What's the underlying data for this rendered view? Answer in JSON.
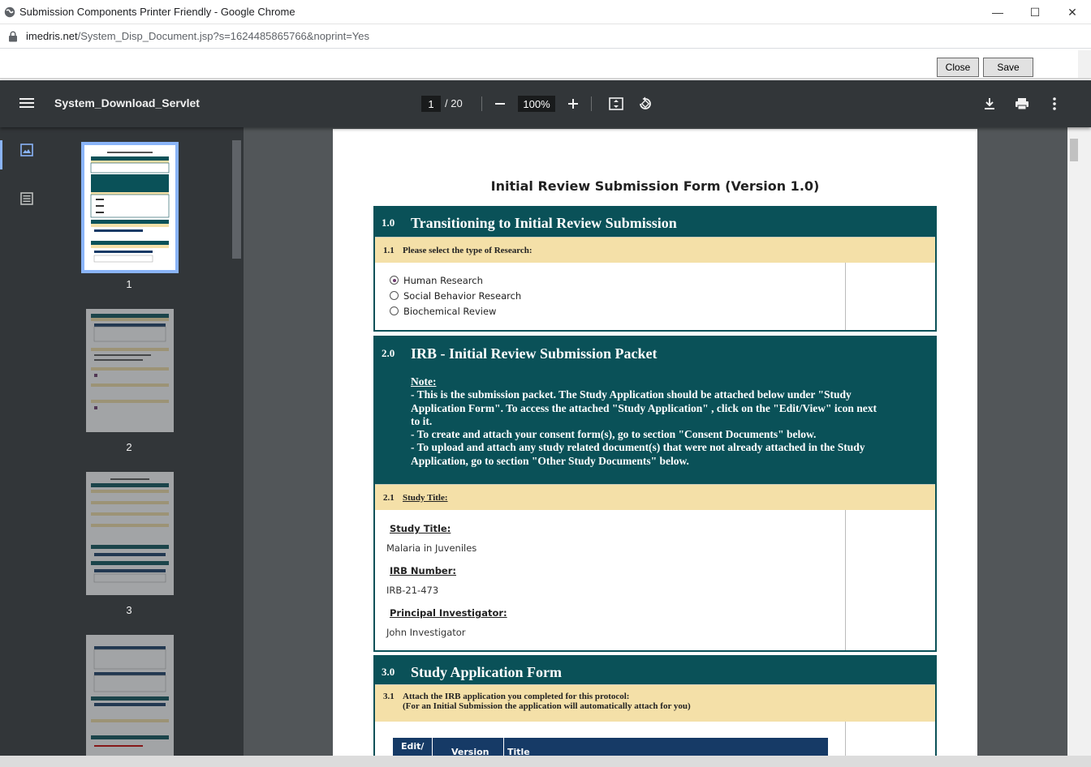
{
  "window": {
    "title": "Submission Components Printer Friendly - Google Chrome",
    "minimize": "—",
    "maximize": "☐",
    "close": "✕"
  },
  "address": {
    "host": "imedris.net",
    "path": "/System_Disp_Document.jsp?s=1624485865766&noprint=Yes"
  },
  "actions": {
    "close_label": "Close",
    "save_label": "Save"
  },
  "viewer": {
    "file_name": "System_Download_Servlet",
    "current_page": "1",
    "total_pages": "/ 20",
    "zoom": "100%",
    "thumb_labels": [
      "1",
      "2",
      "3"
    ]
  },
  "form": {
    "title": "Initial Review Submission Form (Version 1.0)",
    "s1": {
      "num": "1.0",
      "title": "Transitioning to Initial Review Submission",
      "sub_num": "1.1",
      "sub_title": "Please select the type of Research:",
      "options": [
        "Human Research",
        "Social Behavior Research",
        "Biochemical Review"
      ],
      "selected": "Human Research"
    },
    "s2": {
      "num": "2.0",
      "title": "IRB - Initial Review Submission Packet",
      "note_label": "Note:",
      "note_lines": [
        "- This is the submission packet. The Study Application should be attached below under \"Study",
        "Application Form\". To access the attached \"Study Application\" , click on the \"Edit/View\" icon next",
        "to it.",
        "- To create and attach your consent form(s), go to section \"Consent Documents\" below.",
        "- To upload and attach any study related document(s) that were not already attached in the Study",
        "Application, go to section \"Other Study Documents\" below."
      ],
      "sub_num": "2.1",
      "sub_title": "Study Title:",
      "study_title_label": "Study Title:",
      "study_title": "Malaria in Juveniles",
      "irb_label": "IRB Number:",
      "irb_number": "IRB-21-473",
      "pi_label": "Principal Investigator:",
      "pi": "John Investigator"
    },
    "s3": {
      "num": "3.0",
      "title": "Study Application Form",
      "sub_num": "3.1",
      "sub_line1": "Attach the IRB application you completed for this protocol:",
      "sub_line2": "(For an Initial Submission the application will automatically attach for you)",
      "col_edit": "Edit/",
      "col_version": "Version",
      "col_title": "Title"
    }
  }
}
